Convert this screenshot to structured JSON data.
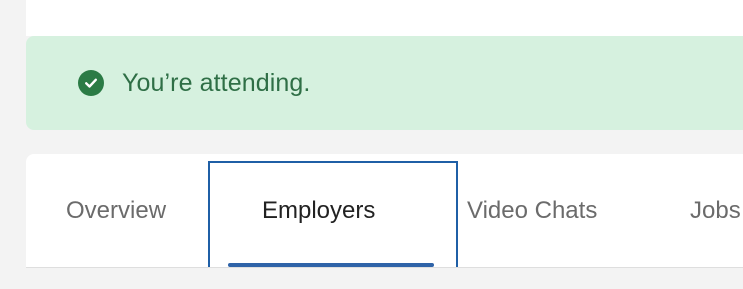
{
  "status_banner": {
    "icon": "check-circle-icon",
    "text": "You’re attending.",
    "background": "#d6f1df",
    "accent": "#2b7b45"
  },
  "tabs": [
    {
      "label": "Overview",
      "selected": false
    },
    {
      "label": "Employers",
      "selected": true
    },
    {
      "label": "Video Chats",
      "selected": false
    },
    {
      "label": "Jobs",
      "selected": false
    }
  ],
  "colors": {
    "active_tab_indicator": "#2f63a8",
    "focus_outline": "#1f5fa6"
  }
}
